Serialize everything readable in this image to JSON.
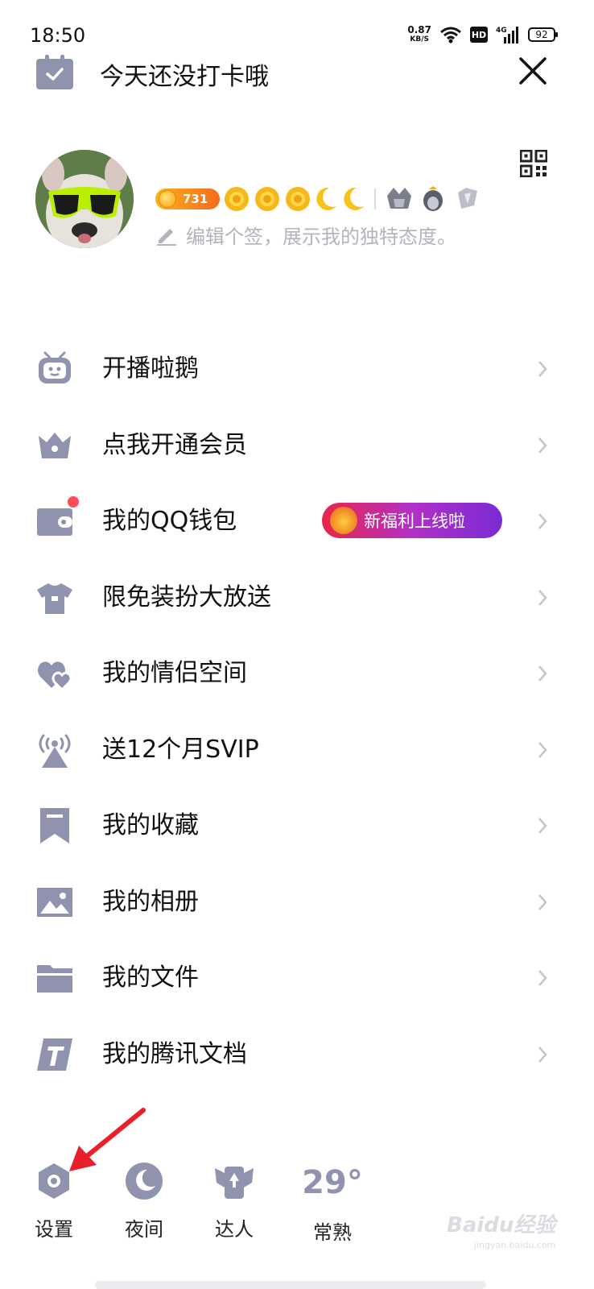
{
  "status_bar": {
    "time": "18:50",
    "net_speed": "0.87",
    "net_unit": "KB/S",
    "hd": "HD",
    "network": "4G",
    "battery": "92"
  },
  "header": {
    "checkin_text": "今天还没打卡哦"
  },
  "profile": {
    "level_value": "731",
    "signature": "编辑个签，展示我的独特态度。"
  },
  "menu": {
    "items": [
      {
        "label": "开播啦鹅"
      },
      {
        "label": "点我开通会员"
      },
      {
        "label": "我的QQ钱包"
      },
      {
        "label": "限免装扮大放送"
      },
      {
        "label": "我的情侣空间"
      },
      {
        "label": "送12个月SVIP"
      },
      {
        "label": "我的收藏"
      },
      {
        "label": "我的相册"
      },
      {
        "label": "我的文件"
      },
      {
        "label": "我的腾讯文档"
      }
    ],
    "wallet_promo": "新福利上线啦"
  },
  "bottom_bar": {
    "settings": "设置",
    "night": "夜间",
    "expert": "达人",
    "temperature": "29°",
    "city": "常熟"
  },
  "watermark": {
    "brand": "Baidu经验",
    "url": "jingyan.baidu.com"
  },
  "colors": {
    "icon_gray": "#8f93ad",
    "red_dot": "#ff4c5b",
    "arrow_red": "#e8202a"
  }
}
